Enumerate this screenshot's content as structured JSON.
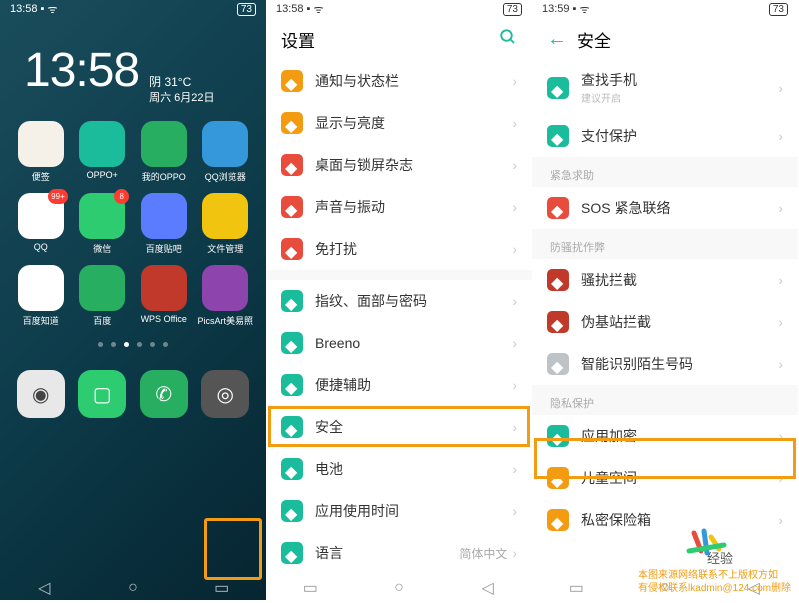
{
  "status": {
    "time1": "13:58",
    "time2": "13:58",
    "time3": "13:59",
    "battery": "73"
  },
  "home": {
    "time": "13:58",
    "weather": "阴 31°C",
    "date": "周六 6月22日",
    "row1": [
      {
        "label": "便签",
        "bg": "#f5f0e8"
      },
      {
        "label": "OPPO+",
        "bg": "#1abc9c"
      },
      {
        "label": "我的OPPO",
        "bg": "#27ae60"
      },
      {
        "label": "QQ浏览器",
        "bg": "#3498db"
      }
    ],
    "row2": [
      {
        "label": "QQ",
        "bg": "#fff",
        "badge": "99+"
      },
      {
        "label": "微信",
        "bg": "#2ecc71",
        "badge": "8"
      },
      {
        "label": "百度贴吧",
        "bg": "#5b7cff"
      },
      {
        "label": "文件管理",
        "bg": "#f1c40f"
      }
    ],
    "row3": [
      {
        "label": "百度知道",
        "bg": "#fff"
      },
      {
        "label": "百度",
        "bg": "#27ae60"
      },
      {
        "label": "WPS Office",
        "bg": "#c0392b"
      },
      {
        "label": "PicsArt美易照",
        "bg": "#8e44ad"
      }
    ]
  },
  "settings": {
    "title": "设置",
    "items": [
      {
        "label": "通知与状态栏",
        "color": "orange"
      },
      {
        "label": "显示与亮度",
        "color": "orange"
      },
      {
        "label": "桌面与锁屏杂志",
        "color": "red"
      },
      {
        "label": "声音与振动",
        "color": "red"
      },
      {
        "label": "免打扰",
        "color": "red"
      },
      {
        "label": "指纹、面部与密码",
        "color": "green"
      },
      {
        "label": "Breeno",
        "color": "green"
      },
      {
        "label": "便捷辅助",
        "color": "green"
      },
      {
        "label": "安全",
        "color": "green"
      },
      {
        "label": "电池",
        "color": "green"
      },
      {
        "label": "应用使用时间",
        "color": "green"
      },
      {
        "label": "语言",
        "color": "green",
        "value": "简体中文"
      }
    ]
  },
  "security": {
    "title": "安全",
    "groups": [
      {
        "label": "",
        "items": [
          {
            "label": "查找手机",
            "sub": "建议开启",
            "color": "green"
          },
          {
            "label": "支付保护",
            "color": "green"
          }
        ]
      },
      {
        "label": "紧急求助",
        "items": [
          {
            "label": "SOS 紧急联络",
            "color": "red"
          }
        ]
      },
      {
        "label": "防骚扰作弊",
        "items": [
          {
            "label": "骚扰拦截",
            "color": "darkred"
          },
          {
            "label": "伪基站拦截",
            "color": "darkred"
          },
          {
            "label": "智能识别陌生号码",
            "color": "gray"
          }
        ]
      },
      {
        "label": "隐私保护",
        "items": [
          {
            "label": "应用加密",
            "color": "green"
          },
          {
            "label": "儿童空间",
            "color": "orange"
          },
          {
            "label": "私密保险箱",
            "color": "orange"
          }
        ]
      }
    ]
  },
  "watermark": {
    "line1": "本图来源网络联系不上版权方如",
    "line2": "有侵权联系lkadmin@124.com删除"
  }
}
